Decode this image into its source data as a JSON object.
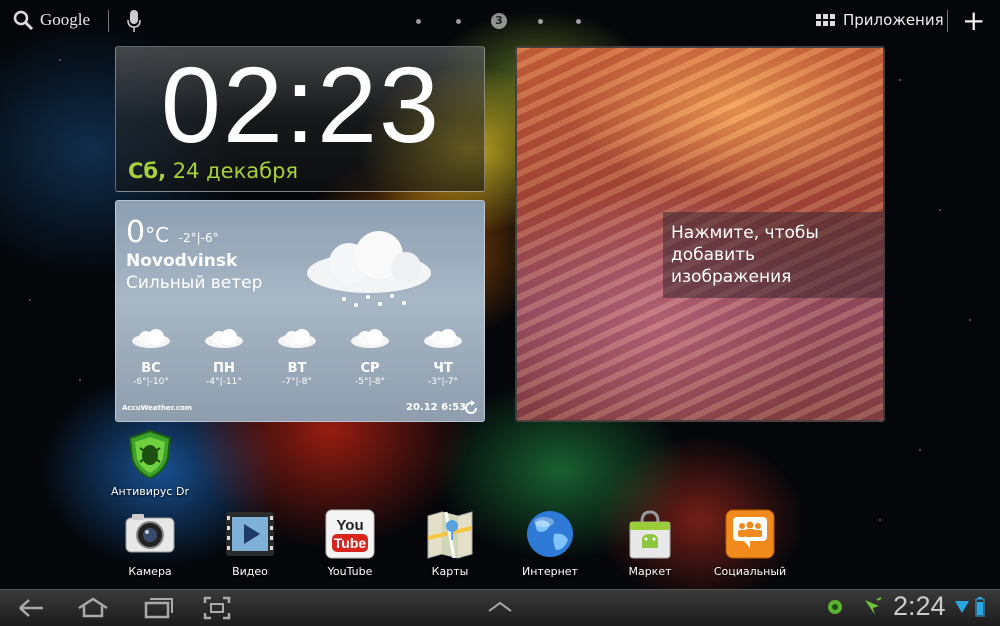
{
  "topbar": {
    "search_label": "Google",
    "pages": {
      "current": "3"
    },
    "apps_label": "Приложения"
  },
  "clock": {
    "time": "02:23",
    "day": "Сб,",
    "date": "24 декабря"
  },
  "weather": {
    "temp": "0",
    "unit": "°C",
    "range": "-2°|-6°",
    "city": "Novodvinsk",
    "condition": "Сильный ветер",
    "forecast": [
      {
        "day": "ВС",
        "range": "-6°|-10°"
      },
      {
        "day": "ПН",
        "range": "-4°|-11°"
      },
      {
        "day": "ВТ",
        "range": "-7°|-8°"
      },
      {
        "day": "СР",
        "range": "-5°|-8°"
      },
      {
        "day": "ЧТ",
        "range": "-3°|-7°"
      }
    ],
    "provider": "AccuWeather.com",
    "updated": "20.12 6:53"
  },
  "photo": {
    "caption": "Нажмите, чтобы добавить изображения"
  },
  "desktop_icons": [
    {
      "label": "Антивирус Dr"
    }
  ],
  "dock": [
    {
      "label": "Камера"
    },
    {
      "label": "Видео"
    },
    {
      "label": "YouTube"
    },
    {
      "label": "Карты"
    },
    {
      "label": "Интернет"
    },
    {
      "label": "Маркет"
    },
    {
      "label": "Социальный"
    }
  ],
  "status": {
    "time": "2:24"
  },
  "colors": {
    "date_accent": "#a6d13a",
    "nav_bg": "#1c1c1c"
  }
}
